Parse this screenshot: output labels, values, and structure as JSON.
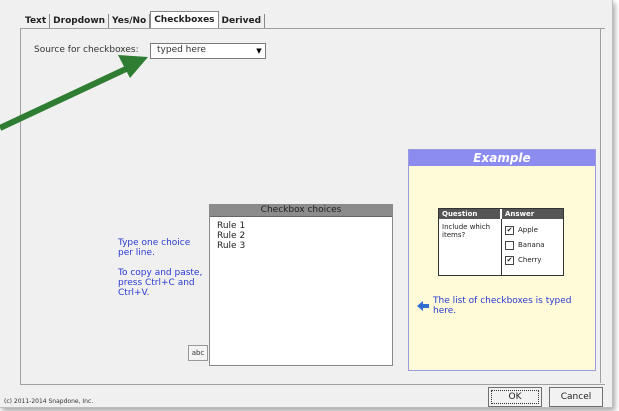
{
  "tabs": [
    {
      "label": "Text",
      "active": false
    },
    {
      "label": "Dropdown",
      "active": false
    },
    {
      "label": "Yes/No",
      "active": false
    },
    {
      "label": "Checkboxes",
      "active": true
    },
    {
      "label": "Derived",
      "active": false
    }
  ],
  "source": {
    "label": "Source for checkboxes:",
    "value": "typed here"
  },
  "hint": {
    "line1": "Type one choice per line.",
    "line2": "To copy and paste, press Ctrl+C and Ctrl+V."
  },
  "choices": {
    "header": "Checkbox choices",
    "lines": [
      "Rule 1",
      "Rule 2",
      "Rule 3"
    ],
    "spellcheck_label": "abc"
  },
  "example": {
    "title": "Example",
    "question_header": "Question",
    "answer_header": "Answer",
    "question": "Include which items?",
    "options": [
      {
        "label": "Apple",
        "checked": true
      },
      {
        "label": "Banana",
        "checked": false
      },
      {
        "label": "Cherry",
        "checked": true
      }
    ],
    "note": "The list of checkboxes is typed here."
  },
  "footer": {
    "copyright": "(c) 2011-2014 Snapdone, Inc.",
    "ok_label": "OK",
    "cancel_label": "Cancel"
  },
  "colors": {
    "hint_text": "#2a3ad0",
    "example_header": "#8c8cf0",
    "example_bg": "#fffbd8",
    "callout_arrow": "#2e7d32"
  }
}
